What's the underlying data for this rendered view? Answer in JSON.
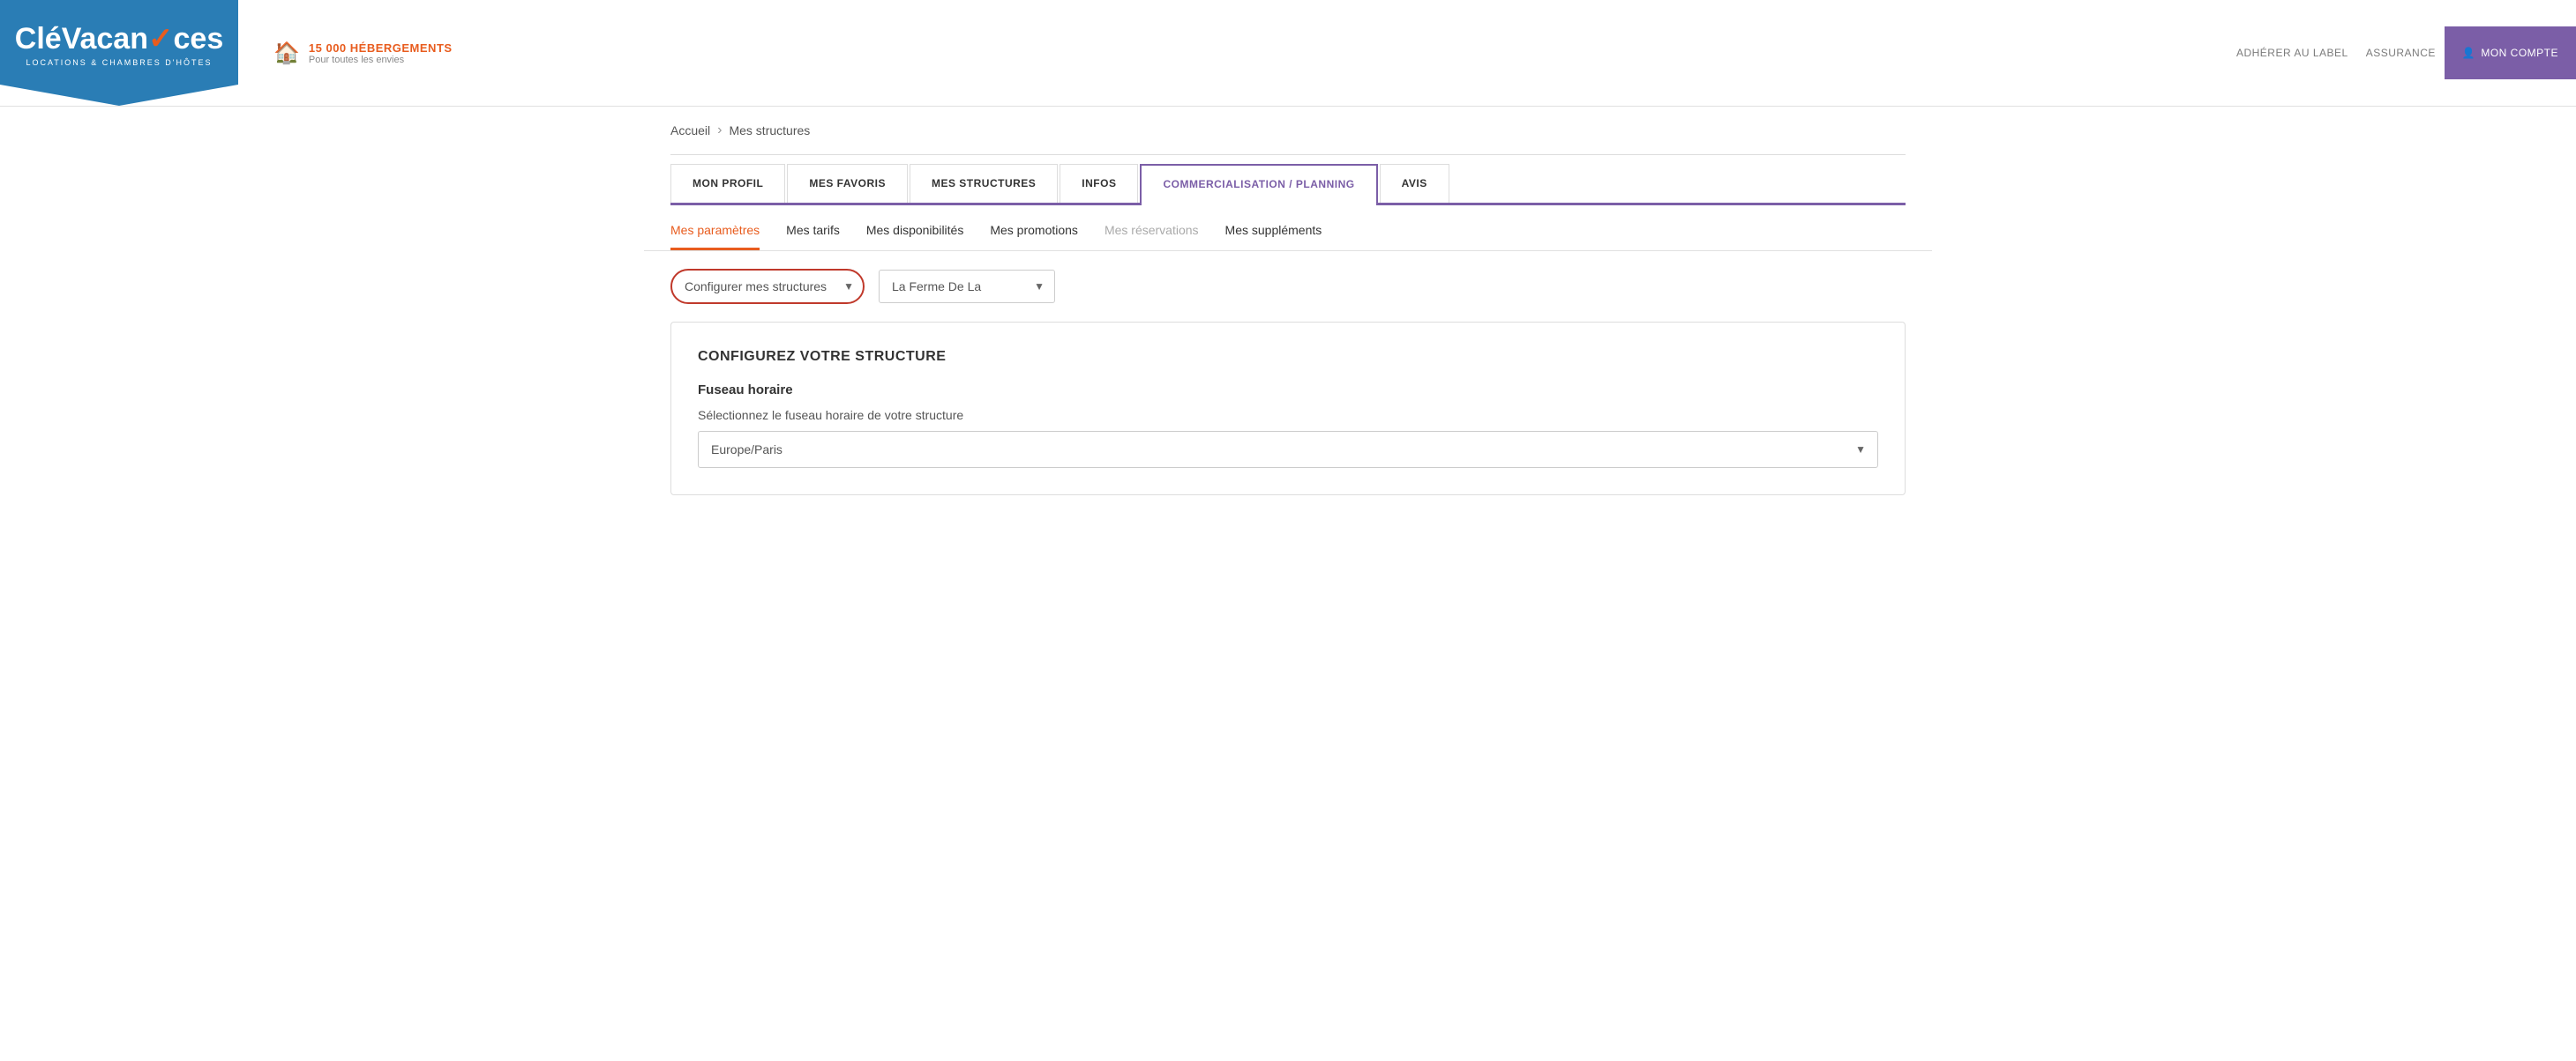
{
  "header": {
    "hebergements_count": "15 000 HÉBERGEMENTS",
    "hebergements_subtitle": "Pour toutes les envies",
    "nav_links": [
      {
        "label": "ADHÉRER AU LABEL",
        "id": "adherer"
      },
      {
        "label": "ASSURANCE",
        "id": "assurance"
      }
    ],
    "mon_compte": "MON COMPTE",
    "mon_compte_icon": "👤"
  },
  "logo": {
    "text_cle": "Clé",
    "text_vacances": "Vacan",
    "text_check": "✓",
    "text_ces": "ces",
    "subtitle": "LOCATIONS & CHAMBRES D'HÔTES"
  },
  "breadcrumb": {
    "home": "Accueil",
    "separator": "›",
    "current": "Mes structures"
  },
  "main_tabs": [
    {
      "label": "MON PROFIL",
      "active": false
    },
    {
      "label": "MES FAVORIS",
      "active": false
    },
    {
      "label": "MES STRUCTURES",
      "active": false
    },
    {
      "label": "INFOS",
      "active": false
    },
    {
      "label": "COMMERCIALISATION / PLANNING",
      "active": true
    },
    {
      "label": "AVIS",
      "active": false
    }
  ],
  "sub_tabs": [
    {
      "label": "Mes paramètres",
      "active": true,
      "disabled": false
    },
    {
      "label": "Mes tarifs",
      "active": false,
      "disabled": false
    },
    {
      "label": "Mes disponibilités",
      "active": false,
      "disabled": false
    },
    {
      "label": "Mes promotions",
      "active": false,
      "disabled": false
    },
    {
      "label": "Mes réservations",
      "active": false,
      "disabled": true
    },
    {
      "label": "Mes suppléments",
      "active": false,
      "disabled": false
    }
  ],
  "dropdowns": {
    "structure_config": {
      "label": "Configurer mes structures",
      "options": [
        "Configurer mes structures"
      ]
    },
    "property": {
      "label": "La Ferme De La",
      "options": [
        "La Ferme De La"
      ]
    }
  },
  "configure_section": {
    "title": "CONFIGUREZ VOTRE STRUCTURE",
    "fuseau_title": "Fuseau horaire",
    "fuseau_label": "Sélectionnez le fuseau horaire de votre structure",
    "timezone_value": "Europe/Paris",
    "timezone_options": [
      "Europe/Paris"
    ]
  }
}
